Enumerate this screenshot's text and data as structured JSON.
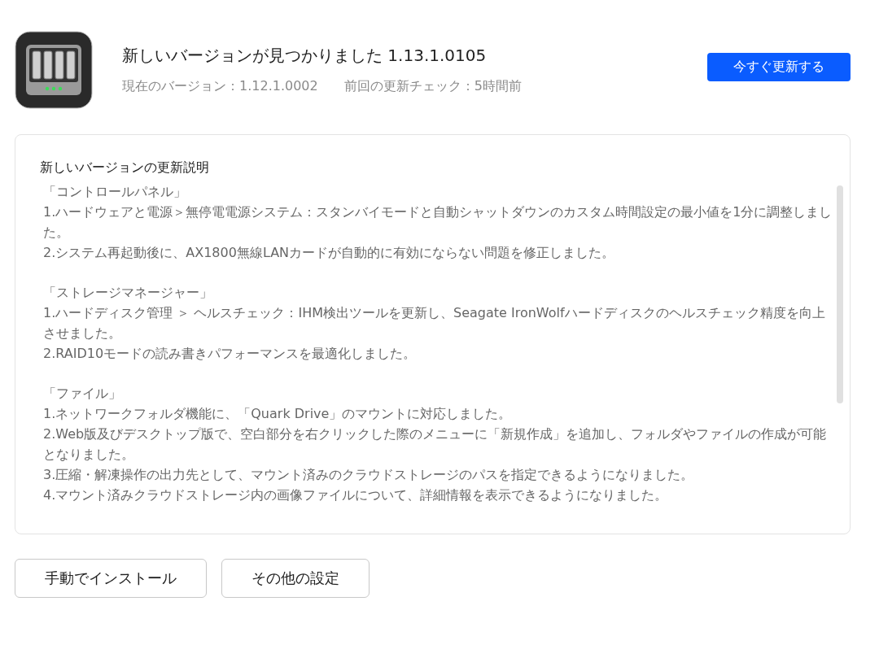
{
  "update": {
    "title": "新しいバージョンが見つかりました 1.13.1.0105",
    "current_version": "現在のバージョン：1.12.1.0002",
    "last_check": "前回の更新チェック：5時間前",
    "update_button": "今すぐ更新する"
  },
  "notes": {
    "heading": "新しいバージョンの更新説明",
    "sections": [
      {
        "title": "「コントロールパネル」",
        "items": [
          "1.ハードウェアと電源＞無停電電源システム：スタンバイモードと自動シャットダウンのカスタム時間設定の最小値を1分に調整しました。",
          "2.システム再起動後に、AX1800無線LANカードが自動的に有効にならない問題を修正しました。"
        ]
      },
      {
        "title": "「ストレージマネージャー」",
        "items": [
          "1.ハードディスク管理 ＞ ヘルスチェック：IHM検出ツールを更新し、Seagate IronWolfハードディスクのヘルスチェック精度を向上させました。",
          "2.RAID10モードの読み書きパフォーマンスを最適化しました。"
        ]
      },
      {
        "title": "「ファイル」",
        "items": [
          "1.ネットワークフォルダ機能に、「Quark  Drive」のマウントに対応しました。",
          "2.Web版及びデスクトップ版で、空白部分を右クリックした際のメニューに「新規作成」を追加し、フォルダやファイルの作成が可能となりました。",
          "3.圧縮・解凍操作の出力先として、マウント済みのクラウドストレージのパスを指定できるようになりました。",
          "4.マウント済みクラウドストレージ内の画像ファイルについて、詳細情報を表示できるようになりました。"
        ]
      }
    ]
  },
  "buttons": [
    "手動でインストール",
    "その他の設定"
  ]
}
